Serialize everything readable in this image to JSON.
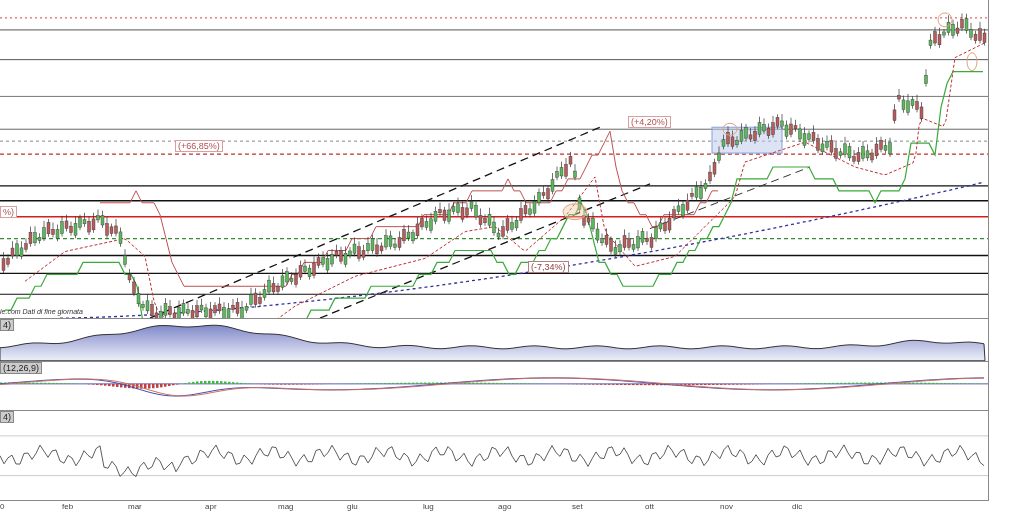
{
  "price_panel": {
    "annotations": [
      {
        "text": "(+66,85%)",
        "kind": "gain"
      },
      {
        "text": "(+4,20%)",
        "kind": "gain"
      },
      {
        "text": "(-7,34%)",
        "kind": "loss"
      },
      {
        "text": "%)",
        "kind": "gain"
      }
    ],
    "source_note": "ie.com  Dati di fine giornata"
  },
  "volume_panel": {
    "label": "4)"
  },
  "macd_panel": {
    "label": "(12,26,9)"
  },
  "rsi_panel": {
    "label": "4)"
  },
  "time_axis": [
    "0",
    "feb",
    "mar",
    "apr",
    "mag",
    "giu",
    "lug",
    "ago",
    "set",
    "ott",
    "nov",
    "dic"
  ]
}
